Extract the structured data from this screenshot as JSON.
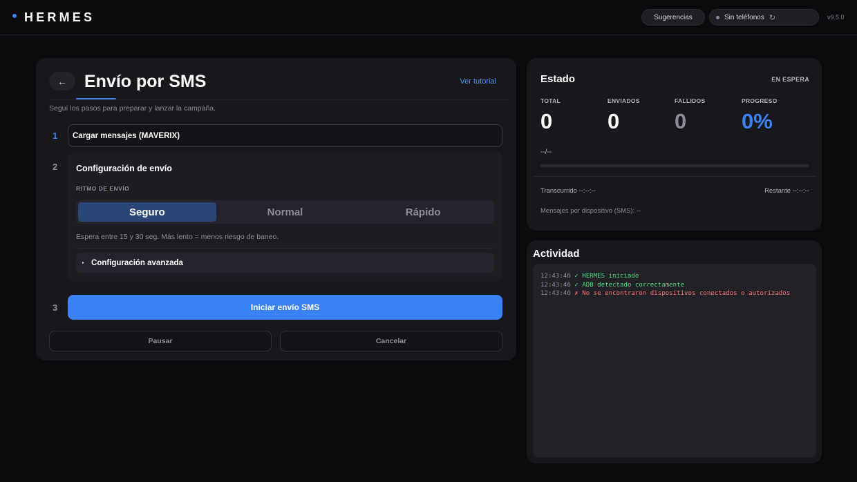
{
  "header": {
    "brand": "HERMES",
    "suggestions_label": "Sugerencias",
    "phones_label": "Sin teléfonos",
    "refresh_icon": "↻",
    "version": "v9.5.0"
  },
  "main": {
    "back_icon": "←",
    "title": "Envío por SMS",
    "tutorial_link": "Ver tutorial",
    "subtitle": "Seguí los pasos para preparar y lanzar la campaña.",
    "steps": {
      "one": {
        "number": "1",
        "label": "Cargar mensajes (MAVERIX)"
      },
      "two": {
        "number": "2",
        "title": "Configuración de envío",
        "pace_label": "RITMO DE ENVÍO",
        "pace_options": [
          "Seguro",
          "Normal",
          "Rápido"
        ],
        "selected_pace": "Seguro",
        "hint": "Espera entre 15 y 30 seg. Más lento = menos riesgo de baneo.",
        "advanced_icon": "▸",
        "advanced_label": "Configuración avanzada"
      },
      "three": {
        "number": "3",
        "start_label": "Iniciar envío SMS"
      }
    },
    "pause_label": "Pausar",
    "cancel_label": "Cancelar"
  },
  "estado": {
    "title": "Estado",
    "status": "EN ESPERA",
    "stats": [
      {
        "label": "TOTAL",
        "value": "0"
      },
      {
        "label": "ENVIADOS",
        "value": "0"
      },
      {
        "label": "FALLIDOS",
        "value": "0"
      },
      {
        "label": "PROGRESO",
        "value": "0%"
      }
    ],
    "ratio": "--/--",
    "progress_fraction": 0,
    "elapsed": "Transcurrido  --:--:--",
    "remaining": "Restante  --:--:--",
    "per_device": "Mensajes por dispositivo (SMS): --"
  },
  "actividad": {
    "title": "Actividad",
    "log": [
      {
        "time": "12:43:46",
        "text": "✓ HERMES iniciado",
        "level": "ok"
      },
      {
        "time": "12:43:46",
        "text": "✓ ADB detectado correctamente",
        "level": "ok"
      },
      {
        "time": "12:43:46",
        "text": "✗ No se encontraron dispositivos conectados o autorizados",
        "level": "err"
      }
    ]
  },
  "colors": {
    "accent": "#3b82f6",
    "success": "#4ade80",
    "error": "#f87171",
    "background": "#0b0b0e",
    "card": "#17171c"
  }
}
